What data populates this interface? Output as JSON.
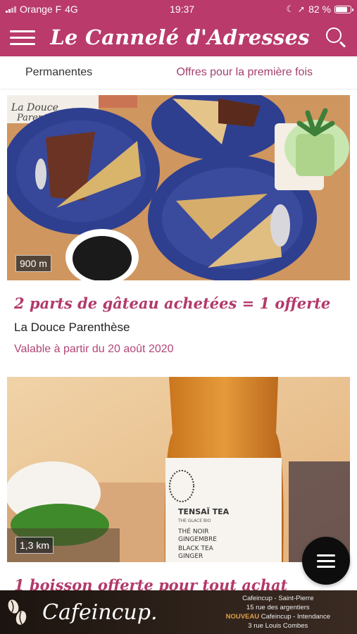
{
  "status_bar": {
    "carrier": "Orange F",
    "network": "4G",
    "time": "19:37",
    "battery_percent": "82 %",
    "battery_level": 0.82
  },
  "header": {
    "title": "Le Cannelé d'Adresses"
  },
  "tabs": [
    {
      "label": "Permanentes"
    },
    {
      "label": "Offres pour la première fois"
    }
  ],
  "offers": [
    {
      "distance": "900 m",
      "title": "2 parts de gâteau achetées = 1 offerte",
      "shop": "La Douce Parenthèse",
      "validity": "Valable à partir du 20 août 2020"
    },
    {
      "distance": "1,3 km",
      "title": "1 boisson offerte pour tout achat"
    }
  ],
  "ad_banner": {
    "logo": "Cafeincup.",
    "line1": "Cafeincup - Saint-Pierre",
    "line2": "15 rue des argentiers",
    "line3_badge": "NOUVEAU",
    "line3": " Cafeincup - Intendance",
    "line4": "3 rue Louis Combes"
  },
  "photo_text": {
    "shop_sign_1": "La Douce",
    "shop_sign_2": "Parenthèse",
    "bottle_brand": "TENSAÏ TEA",
    "bottle_sub": "THE GLACE BIO",
    "bottle_line1": "THÉ NOIR",
    "bottle_line2": "GINGEMBRE",
    "bottle_line3": "BLACK TEA",
    "bottle_line4": "GINGER"
  },
  "colors": {
    "brand": "#b93a6b",
    "offer_title": "#b23a6a",
    "validity": "#b24678"
  }
}
